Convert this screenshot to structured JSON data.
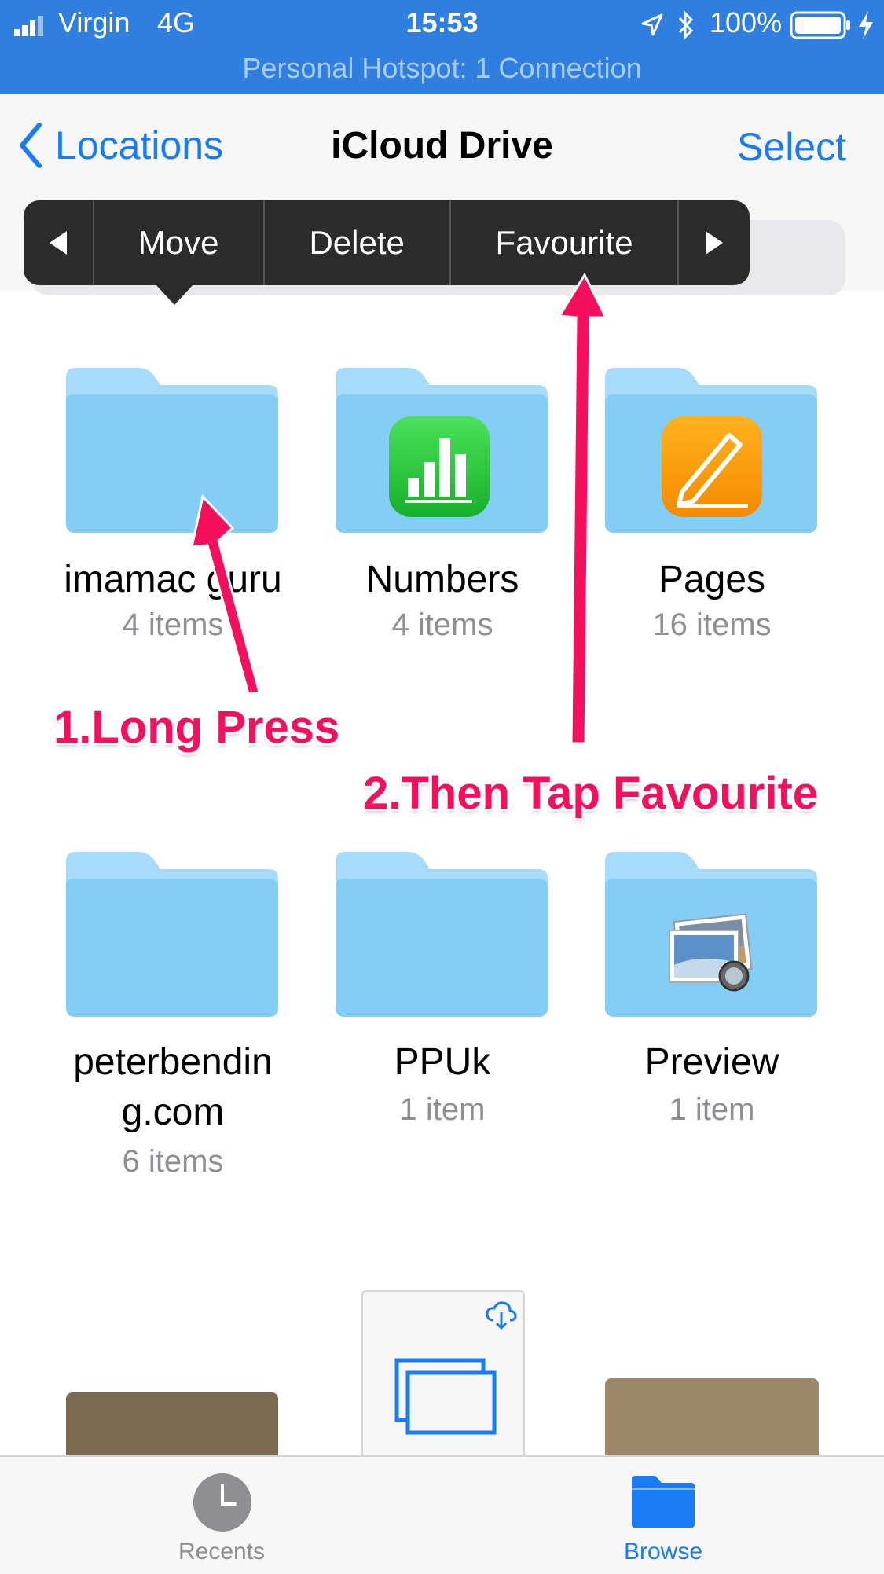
{
  "status_bar": {
    "carrier": "Virgin",
    "network": "4G",
    "time": "15:53",
    "battery": "100%",
    "hotspot": "Personal Hotspot: 1 Connection"
  },
  "nav": {
    "back_label": "Locations",
    "title": "iCloud Drive",
    "select_label": "Select"
  },
  "context_menu": {
    "items": [
      "Move",
      "Delete",
      "Favourite"
    ]
  },
  "folders": [
    {
      "name": "imamac guru",
      "count": "4 items"
    },
    {
      "name": "Numbers",
      "count": "4 items"
    },
    {
      "name": "Pages",
      "count": "16 items"
    },
    {
      "name": "peterbendin",
      "name2": "g.com",
      "count": "6 items"
    },
    {
      "name": "PPUk",
      "count": "1 item"
    },
    {
      "name": "Preview",
      "count": "1 item"
    }
  ],
  "annotations": {
    "step1": "1.Long Press",
    "step2": "2.Then Tap Favourite"
  },
  "tabs": {
    "recents": "Recents",
    "browse": "Browse"
  },
  "colors": {
    "accent": "#1a7cf4",
    "status_bar": "#2f7fe0",
    "annotation": "#f4105c",
    "folder": "#8fd0f7"
  }
}
